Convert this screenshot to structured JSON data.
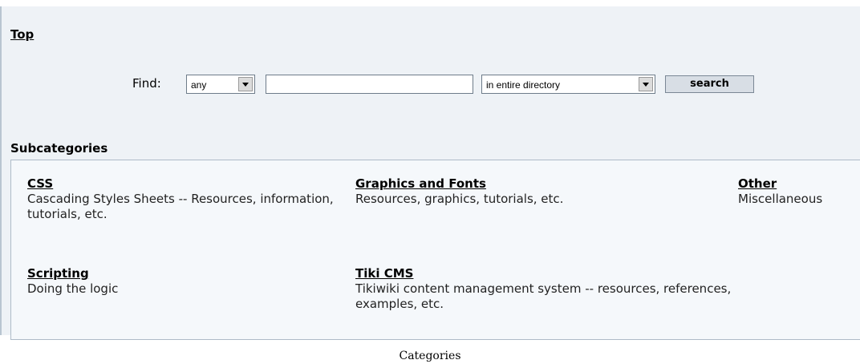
{
  "header": {
    "top_link": "Top"
  },
  "search": {
    "find_label": "Find:",
    "type_select_value": "any",
    "query_value": "",
    "scope_select_value": "in entire directory",
    "search_button": "search"
  },
  "subcategories": {
    "title": "Subcategories",
    "items": [
      {
        "name": "CSS",
        "description": "Cascading Styles Sheets -- Resources, information, tutorials, etc."
      },
      {
        "name": "Graphics and Fonts",
        "description": "Resources, graphics, tutorials, etc."
      },
      {
        "name": "Other",
        "description": "Miscellaneous"
      },
      {
        "name": "Scripting",
        "description": "Doing the logic"
      },
      {
        "name": "Tiki CMS",
        "description": "Tikiwiki content management system -- resources, references, examples, etc."
      }
    ]
  },
  "caption": "Categories"
}
